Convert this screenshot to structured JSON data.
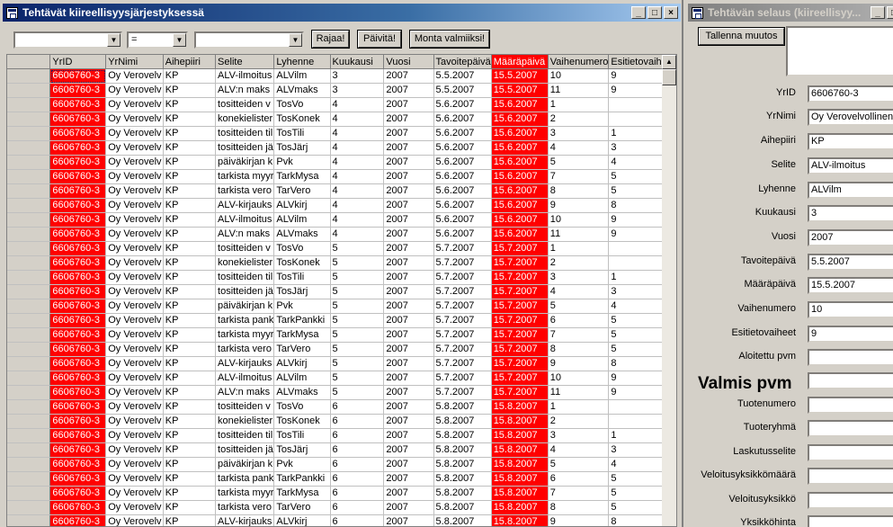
{
  "left_window": {
    "title": "Tehtävät kiireellisyysjärjestyksessä",
    "caption_buttons": [
      "_",
      "□",
      "×"
    ],
    "filter": {
      "field_value": "",
      "operator_value": "=",
      "criteria_value": ""
    },
    "buttons": {
      "limit": "Rajaa!",
      "update": "Päivitä!",
      "many_done": "Monta valmiiksi!"
    },
    "columns": [
      "YrID",
      "YrNimi",
      "Aihepiiri",
      "Selite",
      "Lyhenne",
      "Kuukausi",
      "Vuosi",
      "Tavoitepäivä",
      "Määräpäivä",
      "Vaihenumero",
      "Esitietovaiheet"
    ],
    "rows": [
      [
        "6606760-3",
        "Oy Verovelv",
        "KP",
        "ALV-ilmoitus",
        "ALVilm",
        "3",
        "2007",
        "5.5.2007",
        "15.5.2007",
        "10",
        "9"
      ],
      [
        "6606760-3",
        "Oy Verovelv",
        "KP",
        "ALV:n maks",
        "ALVmaks",
        "3",
        "2007",
        "5.5.2007",
        "15.5.2007",
        "11",
        "9"
      ],
      [
        "6606760-3",
        "Oy Verovelv",
        "KP",
        "tositteiden v",
        "TosVo",
        "4",
        "2007",
        "5.6.2007",
        "15.6.2007",
        "1",
        ""
      ],
      [
        "6606760-3",
        "Oy Verovelv",
        "KP",
        "konekielister",
        "TosKonek",
        "4",
        "2007",
        "5.6.2007",
        "15.6.2007",
        "2",
        ""
      ],
      [
        "6606760-3",
        "Oy Verovelv",
        "KP",
        "tositteiden til",
        "TosTili",
        "4",
        "2007",
        "5.6.2007",
        "15.6.2007",
        "3",
        "1"
      ],
      [
        "6606760-3",
        "Oy Verovelv",
        "KP",
        "tositteiden jä",
        "TosJärj",
        "4",
        "2007",
        "5.6.2007",
        "15.6.2007",
        "4",
        "3"
      ],
      [
        "6606760-3",
        "Oy Verovelv",
        "KP",
        "päiväkirjan k",
        "Pvk",
        "4",
        "2007",
        "5.6.2007",
        "15.6.2007",
        "5",
        "4"
      ],
      [
        "6606760-3",
        "Oy Verovelv",
        "KP",
        "tarkista myyr",
        "TarkMysa",
        "4",
        "2007",
        "5.6.2007",
        "15.6.2007",
        "7",
        "5"
      ],
      [
        "6606760-3",
        "Oy Verovelv",
        "KP",
        "tarkista vero",
        "TarVero",
        "4",
        "2007",
        "5.6.2007",
        "15.6.2007",
        "8",
        "5"
      ],
      [
        "6606760-3",
        "Oy Verovelv",
        "KP",
        "ALV-kirjauks",
        "ALVkirj",
        "4",
        "2007",
        "5.6.2007",
        "15.6.2007",
        "9",
        "8"
      ],
      [
        "6606760-3",
        "Oy Verovelv",
        "KP",
        "ALV-ilmoitus",
        "ALVilm",
        "4",
        "2007",
        "5.6.2007",
        "15.6.2007",
        "10",
        "9"
      ],
      [
        "6606760-3",
        "Oy Verovelv",
        "KP",
        "ALV:n maks",
        "ALVmaks",
        "4",
        "2007",
        "5.6.2007",
        "15.6.2007",
        "11",
        "9"
      ],
      [
        "6606760-3",
        "Oy Verovelv",
        "KP",
        "tositteiden v",
        "TosVo",
        "5",
        "2007",
        "5.7.2007",
        "15.7.2007",
        "1",
        ""
      ],
      [
        "6606760-3",
        "Oy Verovelv",
        "KP",
        "konekielister",
        "TosKonek",
        "5",
        "2007",
        "5.7.2007",
        "15.7.2007",
        "2",
        ""
      ],
      [
        "6606760-3",
        "Oy Verovelv",
        "KP",
        "tositteiden til",
        "TosTili",
        "5",
        "2007",
        "5.7.2007",
        "15.7.2007",
        "3",
        "1"
      ],
      [
        "6606760-3",
        "Oy Verovelv",
        "KP",
        "tositteiden jä",
        "TosJärj",
        "5",
        "2007",
        "5.7.2007",
        "15.7.2007",
        "4",
        "3"
      ],
      [
        "6606760-3",
        "Oy Verovelv",
        "KP",
        "päiväkirjan k",
        "Pvk",
        "5",
        "2007",
        "5.7.2007",
        "15.7.2007",
        "5",
        "4"
      ],
      [
        "6606760-3",
        "Oy Verovelv",
        "KP",
        "tarkista pank",
        "TarkPankki",
        "5",
        "2007",
        "5.7.2007",
        "15.7.2007",
        "6",
        "5"
      ],
      [
        "6606760-3",
        "Oy Verovelv",
        "KP",
        "tarkista myyr",
        "TarkMysa",
        "5",
        "2007",
        "5.7.2007",
        "15.7.2007",
        "7",
        "5"
      ],
      [
        "6606760-3",
        "Oy Verovelv",
        "KP",
        "tarkista vero",
        "TarVero",
        "5",
        "2007",
        "5.7.2007",
        "15.7.2007",
        "8",
        "5"
      ],
      [
        "6606760-3",
        "Oy Verovelv",
        "KP",
        "ALV-kirjauks",
        "ALVkirj",
        "5",
        "2007",
        "5.7.2007",
        "15.7.2007",
        "9",
        "8"
      ],
      [
        "6606760-3",
        "Oy Verovelv",
        "KP",
        "ALV-ilmoitus",
        "ALVilm",
        "5",
        "2007",
        "5.7.2007",
        "15.7.2007",
        "10",
        "9"
      ],
      [
        "6606760-3",
        "Oy Verovelv",
        "KP",
        "ALV:n maks",
        "ALVmaks",
        "5",
        "2007",
        "5.7.2007",
        "15.7.2007",
        "11",
        "9"
      ],
      [
        "6606760-3",
        "Oy Verovelv",
        "KP",
        "tositteiden v",
        "TosVo",
        "6",
        "2007",
        "5.8.2007",
        "15.8.2007",
        "1",
        ""
      ],
      [
        "6606760-3",
        "Oy Verovelv",
        "KP",
        "konekielister",
        "TosKonek",
        "6",
        "2007",
        "5.8.2007",
        "15.8.2007",
        "2",
        ""
      ],
      [
        "6606760-3",
        "Oy Verovelv",
        "KP",
        "tositteiden til",
        "TosTili",
        "6",
        "2007",
        "5.8.2007",
        "15.8.2007",
        "3",
        "1"
      ],
      [
        "6606760-3",
        "Oy Verovelv",
        "KP",
        "tositteiden jä",
        "TosJärj",
        "6",
        "2007",
        "5.8.2007",
        "15.8.2007",
        "4",
        "3"
      ],
      [
        "6606760-3",
        "Oy Verovelv",
        "KP",
        "päiväkirjan k",
        "Pvk",
        "6",
        "2007",
        "5.8.2007",
        "15.8.2007",
        "5",
        "4"
      ],
      [
        "6606760-3",
        "Oy Verovelv",
        "KP",
        "tarkista pank",
        "TarkPankki",
        "6",
        "2007",
        "5.8.2007",
        "15.8.2007",
        "6",
        "5"
      ],
      [
        "6606760-3",
        "Oy Verovelv",
        "KP",
        "tarkista myyr",
        "TarkMysa",
        "6",
        "2007",
        "5.8.2007",
        "15.8.2007",
        "7",
        "5"
      ],
      [
        "6606760-3",
        "Oy Verovelv",
        "KP",
        "tarkista vero",
        "TarVero",
        "6",
        "2007",
        "5.8.2007",
        "15.8.2007",
        "8",
        "5"
      ],
      [
        "6606760-3",
        "Oy Verovelv",
        "KP",
        "ALV-kirjauks",
        "ALVkirj",
        "6",
        "2007",
        "5.8.2007",
        "15.8.2007",
        "9",
        "8"
      ]
    ],
    "highlight_color": "#ff0000"
  },
  "right_window": {
    "title": "Tehtävän selaus (kiireellisyy...",
    "caption_buttons": [
      "_",
      "□"
    ],
    "save_button": "Tallenna muutos",
    "fields": [
      {
        "label": "YrID",
        "value": "6606760-3"
      },
      {
        "label": "YrNimi",
        "value": "Oy Verovelvollinen A"
      },
      {
        "label": "Aihepiiri",
        "value": "KP"
      },
      {
        "label": "Selite",
        "value": "ALV-ilmoitus"
      },
      {
        "label": "Lyhenne",
        "value": "ALVilm"
      },
      {
        "label": "Kuukausi",
        "value": "3"
      },
      {
        "label": "Vuosi",
        "value": "2007"
      },
      {
        "label": "Tavoitepäivä",
        "value": "5.5.2007"
      },
      {
        "label": "Määräpäivä",
        "value": "15.5.2007"
      },
      {
        "label": "Vaihenumero",
        "value": "10"
      },
      {
        "label": "Esitietovaiheet",
        "value": "9"
      },
      {
        "label": "Aloitettu pvm",
        "value": ""
      }
    ],
    "done_label": "Valmis pvm",
    "fields_after": [
      {
        "label": "Tuotenumero",
        "value": ""
      },
      {
        "label": "Tuoteryhmä",
        "value": ""
      },
      {
        "label": "Laskutusselite",
        "value": ""
      },
      {
        "label": "Veloitusyksikkömäärä",
        "value": ""
      },
      {
        "label": "Veloitusyksikkö",
        "value": ""
      },
      {
        "label": "Yksikköhinta",
        "value": ""
      }
    ]
  }
}
